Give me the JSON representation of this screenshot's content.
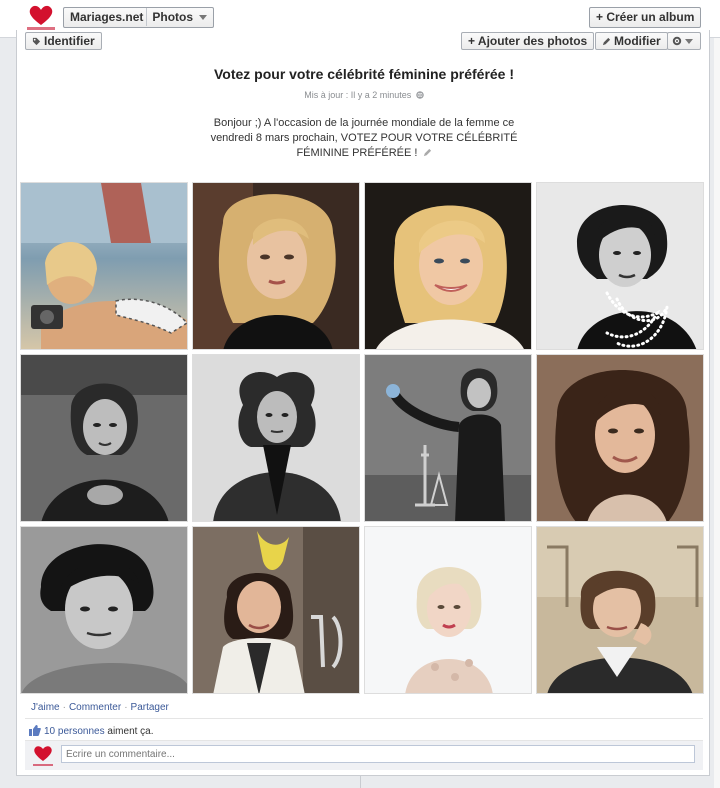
{
  "header": {
    "page_name": "Mariages.net",
    "section": "Photos",
    "create_album": "+ Créer un album"
  },
  "toolbar": {
    "tag": "Identifier",
    "add_photos": "+ Ajouter des photos",
    "edit": "Modifier"
  },
  "album": {
    "title": "Votez pour votre célébrité féminine préférée !",
    "updated": "Mis à jour : Il y a 2 minutes",
    "description": "Bonjour ;) A l'occasion de la journée mondiale de la femme ce vendredi 8 mars prochain, VOTEZ POUR VOTRE CÉLÉBRITÉ FÉMININE PRÉFÉRÉE !"
  },
  "actions": {
    "like": "J'aime",
    "comment": "Commenter",
    "share": "Partager"
  },
  "likes": {
    "link": "10 personnes",
    "text": " aiment ça."
  },
  "comment": {
    "placeholder": "Écrire un commentaire..."
  },
  "colors": {
    "link": "#3b5998",
    "heart": "#d3112e"
  },
  "icons": [
    "heart-logo-icon",
    "tag-icon",
    "pencil-icon",
    "gear-icon",
    "chevron-down-icon",
    "thumbs-up-icon",
    "globe-icon"
  ]
}
